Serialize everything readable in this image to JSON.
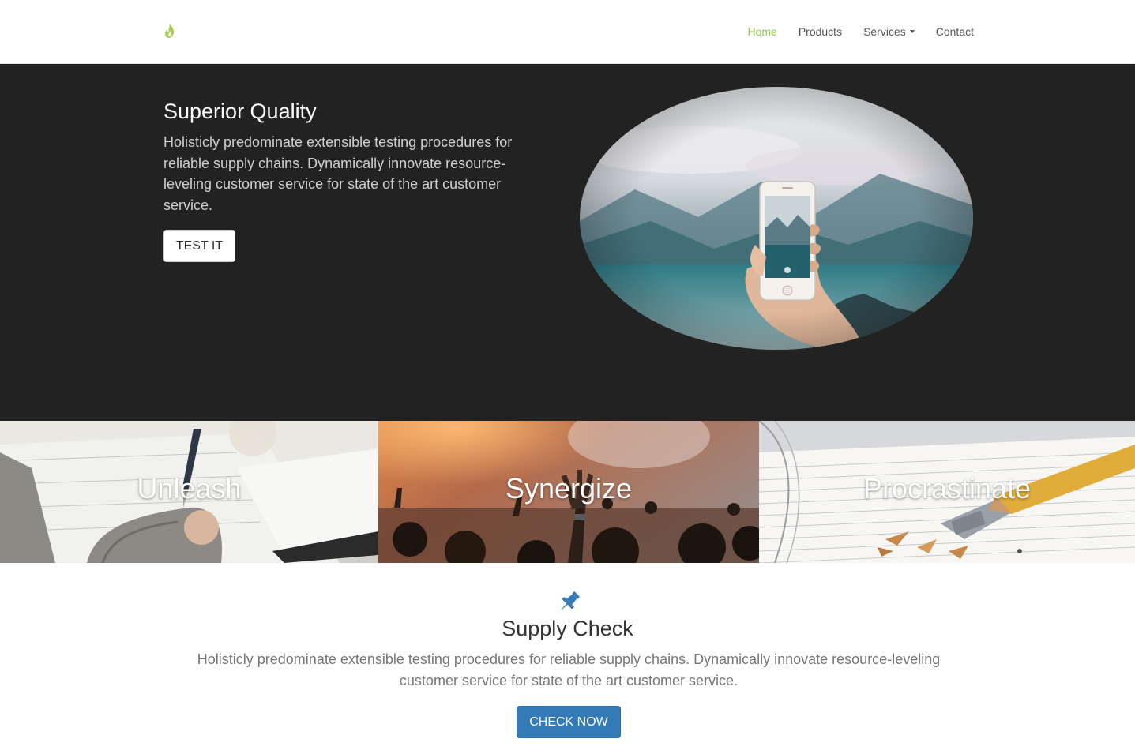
{
  "brand": {
    "logo_icon": "flame-icon",
    "accent_color": "#8cc63f"
  },
  "nav": {
    "items": [
      {
        "label": "Home",
        "active": true
      },
      {
        "label": "Products",
        "active": false
      },
      {
        "label": "Services",
        "active": false,
        "dropdown": true
      },
      {
        "label": "Contact",
        "active": false
      }
    ]
  },
  "hero": {
    "title": "Superior Quality",
    "text": "Holisticly predominate extensible testing procedures for reliable supply chains. Dynamically innovate resource-leveling customer service for state of the art customer service.",
    "button_label": "TEST IT",
    "background_color": "#222222"
  },
  "tiles": [
    {
      "label": "Unleash"
    },
    {
      "label": "Synergize"
    },
    {
      "label": "Procrastinate"
    }
  ],
  "supply_check": {
    "icon": "pushpin-icon",
    "title": "Supply Check",
    "text": "Holisticly predominate extensible testing procedures for reliable supply chains. Dynamically innovate resource-leveling customer service for state of the art customer service.",
    "button_label": "CHECK NOW",
    "button_color": "#337ab7"
  }
}
